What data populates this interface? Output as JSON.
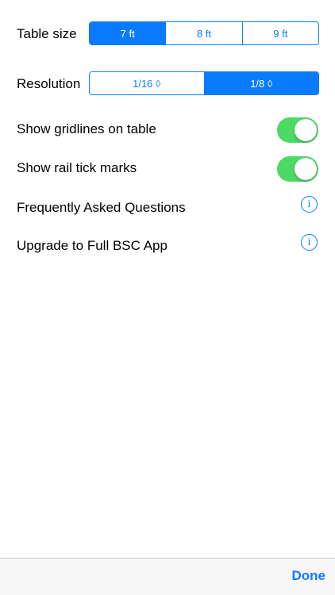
{
  "settings": {
    "table_size": {
      "label": "Table size",
      "options": [
        "7 ft",
        "8 ft",
        "9 ft"
      ],
      "selected": "7 ft"
    },
    "resolution": {
      "label": "Resolution",
      "options": [
        "1/16 ◊",
        "1/8 ◊"
      ],
      "selected": "1/8 ◊"
    },
    "show_gridlines": {
      "label": "Show gridlines on table",
      "on": true
    },
    "show_rail_ticks": {
      "label": "Show rail tick marks",
      "on": true
    },
    "faq": {
      "label": "Frequently Asked Questions",
      "icon": "info-icon"
    },
    "upgrade": {
      "label": "Upgrade to Full BSC App",
      "icon": "info-icon"
    }
  },
  "info_glyph": "i",
  "toolbar": {
    "done_label": "Done"
  },
  "colors": {
    "accent": "#0a7aff",
    "toggle_on": "#4cd964"
  }
}
